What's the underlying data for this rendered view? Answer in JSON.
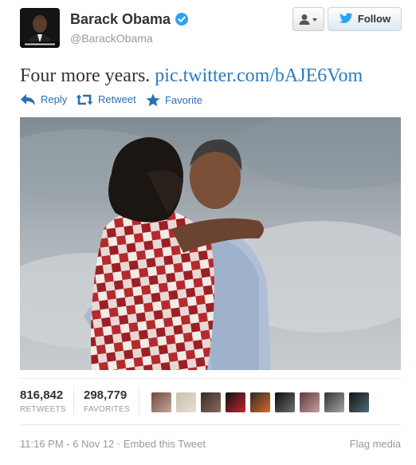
{
  "user": {
    "display_name": "Barack Obama",
    "handle": "@BarackObama",
    "verified_icon": "verified-badge-icon"
  },
  "buttons": {
    "user_menu_icon": "user-dropdown-icon",
    "follow_label": "Follow"
  },
  "tweet": {
    "text": "Four more years.",
    "link": "pic.twitter.com/bAJE6Vom"
  },
  "actions": [
    {
      "label": "Reply",
      "icon": "reply-arrow-icon"
    },
    {
      "label": "Retweet",
      "icon": "retweet-icon"
    },
    {
      "label": "Favorite",
      "icon": "star-icon"
    }
  ],
  "stats": {
    "retweets_count": "816,842",
    "retweets_label": "RETWEETS",
    "favorites_count": "298,779",
    "favorites_label": "FAVORITES"
  },
  "footer": {
    "timestamp": "11:16 PM - 6 Nov 12",
    "separator": "·",
    "embed_label": "Embed this Tweet",
    "flag_label": "Flag media"
  },
  "colors": {
    "link": "#2a7bbf",
    "action": "#2a6fb5",
    "verified": "#2aa3ef",
    "muted": "#999999"
  }
}
